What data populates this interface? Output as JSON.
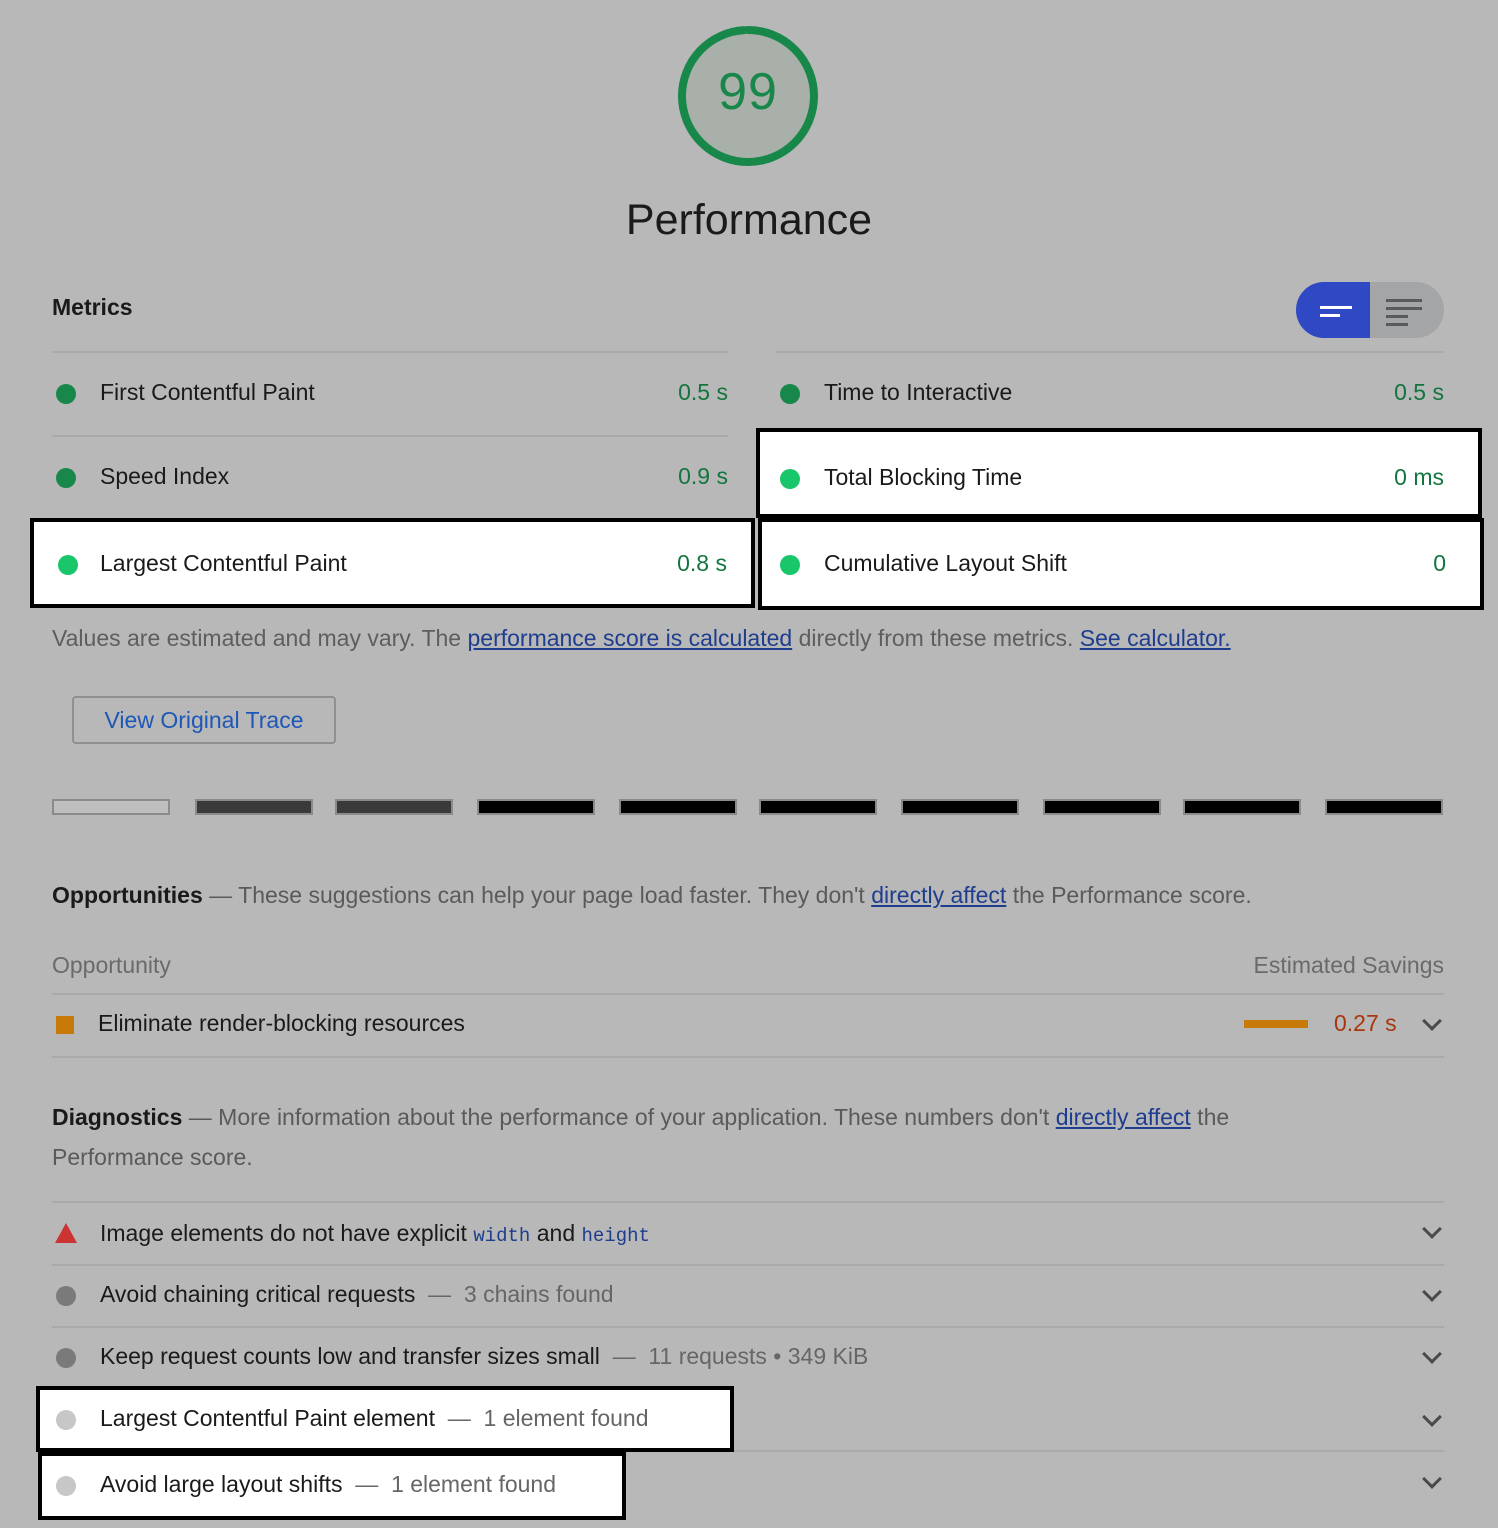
{
  "score": {
    "value": "99",
    "fraction": 0.99,
    "color": "#18874a"
  },
  "category_title": "Performance",
  "metrics": {
    "heading": "Metrics",
    "items": [
      {
        "label": "First Contentful Paint",
        "value": "0.5 s"
      },
      {
        "label": "Time to Interactive",
        "value": "0.5 s"
      },
      {
        "label": "Speed Index",
        "value": "0.9 s"
      },
      {
        "label": "Total Blocking Time",
        "value": "0 ms"
      },
      {
        "label": "Largest Contentful Paint",
        "value": "0.8 s"
      },
      {
        "label": "Cumulative Layout Shift",
        "value": "0"
      }
    ],
    "note_prefix": "Values are estimated and may vary. The ",
    "note_link1": "performance score is calculated",
    "note_mid": " directly from these metrics. ",
    "note_link2": "See calculator."
  },
  "trace_button": "View Original Trace",
  "opportunities": {
    "heading": "Opportunities",
    "dash": " — ",
    "desc_prefix": "These suggestions can help your page load faster. They don't ",
    "desc_link": "directly affect",
    "desc_suffix": " the Performance score.",
    "col_left": "Opportunity",
    "col_right": "Estimated Savings",
    "items": [
      {
        "label": "Eliminate render-blocking resources",
        "savings": "0.27 s"
      }
    ]
  },
  "diagnostics": {
    "heading": "Diagnostics",
    "dash": " — ",
    "desc_prefix": "More information about the performance of your application. These numbers don't ",
    "desc_link": "directly affect",
    "desc_suffix": " the",
    "desc_line2": "Performance score.",
    "items": [
      {
        "label_a": "Image elements do not have explicit ",
        "code_a": "width",
        "label_b": " and ",
        "code_b": "height"
      },
      {
        "label": "Avoid chaining critical requests",
        "sub": "3 chains found"
      },
      {
        "label": "Keep request counts low and transfer sizes small",
        "sub": "11 requests • 349 KiB"
      },
      {
        "label": "Largest Contentful Paint element",
        "sub": "1 element found"
      },
      {
        "label": "Avoid large layout shifts",
        "sub": "1 element found"
      }
    ]
  },
  "colors": {
    "pass": "#18874a",
    "pass_bright": "#19c66a",
    "average": "#c77a0a",
    "fail": "#c33",
    "savings_text": "#a8360e",
    "accent": "#2f48c4"
  },
  "icons": {
    "view_toggle_active": "summary-lines-icon",
    "view_toggle_inactive": "detail-lines-icon",
    "expand": "chevron-down-icon",
    "fail": "red-triangle-icon",
    "average": "orange-square-icon",
    "info": "gray-circle-icon"
  }
}
